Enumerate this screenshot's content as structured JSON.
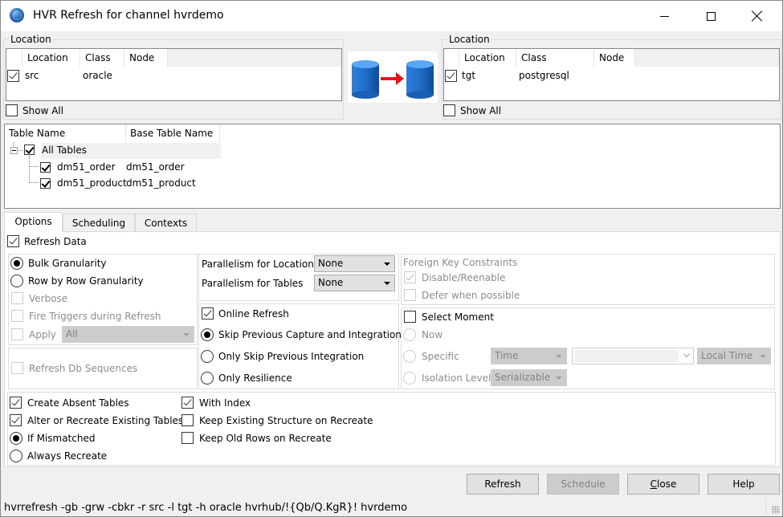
{
  "window": {
    "title": "HVR Refresh for channel hvrdemo",
    "controls": {
      "minimize": "minimize",
      "maximize": "maximize",
      "close": "close"
    }
  },
  "source_location": {
    "group_label": "Location",
    "columns": [
      "Location",
      "Class",
      "Node"
    ],
    "rows": [
      {
        "checked": true,
        "location": "src",
        "class": "oracle",
        "node": ""
      }
    ],
    "show_all_label": "Show All",
    "show_all_checked": false
  },
  "replication_graphic": {
    "icon": "database-to-database-arrow-icon"
  },
  "target_location": {
    "group_label": "Location",
    "columns": [
      "Location",
      "Class",
      "Node"
    ],
    "rows": [
      {
        "checked": true,
        "location": "tgt",
        "class": "postgresql",
        "node": ""
      }
    ],
    "show_all_label": "Show All",
    "show_all_checked": false
  },
  "tables": {
    "columns": [
      "Table Name",
      "Base Table Name"
    ],
    "root": {
      "label": "All Tables",
      "checked": true,
      "expanded": true
    },
    "rows": [
      {
        "name": "dm51_order",
        "base_name": "dm51_order",
        "checked": true
      },
      {
        "name": "dm51_product",
        "base_name": "dm51_product",
        "checked": true
      }
    ]
  },
  "tabs": [
    {
      "label": "Options",
      "active": true
    },
    {
      "label": "Scheduling",
      "active": false
    },
    {
      "label": "Contexts",
      "active": false
    }
  ],
  "options": {
    "refresh_data": {
      "label": "Refresh Data",
      "checked": true
    },
    "granularity": {
      "bulk": {
        "label": "Bulk Granularity",
        "selected": true
      },
      "row_by_row": {
        "label": "Row by Row Granularity",
        "selected": false
      },
      "verbose": {
        "label": "Verbose",
        "checked": false,
        "enabled": false
      },
      "fire_triggers": {
        "label": "Fire Triggers during Refresh",
        "checked": false,
        "enabled": false
      },
      "apply": {
        "label": "Apply",
        "checked": false,
        "enabled": false,
        "value": "All"
      }
    },
    "refresh_db_sequences": {
      "label": "Refresh Db Sequences",
      "checked": false,
      "enabled": false
    },
    "parallelism": {
      "locations_label": "Parallelism for Locations",
      "locations_value": "None",
      "tables_label": "Parallelism for Tables",
      "tables_value": "None"
    },
    "online_refresh": {
      "label": "Online Refresh",
      "checked": true,
      "skip_capture_integration": {
        "label": "Skip Previous Capture and Integration",
        "selected": true
      },
      "only_skip_integration": {
        "label": "Only Skip Previous Integration",
        "selected": false
      },
      "only_resilience": {
        "label": "Only Resilience",
        "selected": false
      }
    },
    "foreign_keys": {
      "title": "Foreign Key Constraints",
      "disable_reenable": {
        "label": "Disable/Reenable",
        "checked": true,
        "enabled": false
      },
      "defer": {
        "label": "Defer when possible",
        "checked": false,
        "enabled": false
      }
    },
    "select_moment": {
      "label": "Select Moment",
      "checked": false,
      "now": {
        "label": "Now",
        "enabled": false
      },
      "specific": {
        "label": "Specific",
        "enabled": false,
        "type_value": "Time",
        "value": "",
        "timezone_value": "Local Time"
      },
      "isolation_level": {
        "label": "Isolation Level",
        "enabled": false,
        "value": "Serializable"
      }
    },
    "table_creation": {
      "create_absent": {
        "label": "Create Absent Tables",
        "checked": true
      },
      "alter_recreate": {
        "label": "Alter or Recreate Existing Tables",
        "checked": true
      },
      "if_mismatched": {
        "label": "If Mismatched",
        "selected": true
      },
      "always_recreate": {
        "label": "Always Recreate",
        "selected": false
      },
      "with_index": {
        "label": "With Index",
        "checked": true
      },
      "keep_structure": {
        "label": "Keep Existing Structure on Recreate",
        "checked": false
      },
      "keep_old_rows": {
        "label": "Keep Old Rows on Recreate",
        "checked": false
      }
    }
  },
  "buttons": {
    "refresh": "Refresh",
    "schedule": "Schedule",
    "close_prefix": "C",
    "close_rest": "lose",
    "help": "Help"
  },
  "status_bar": {
    "command": "hvrrefresh -gb -grw -cbkr -r src -l tgt -h oracle hvrhub/!{Qb/Q.KgR}! hvrdemo"
  }
}
